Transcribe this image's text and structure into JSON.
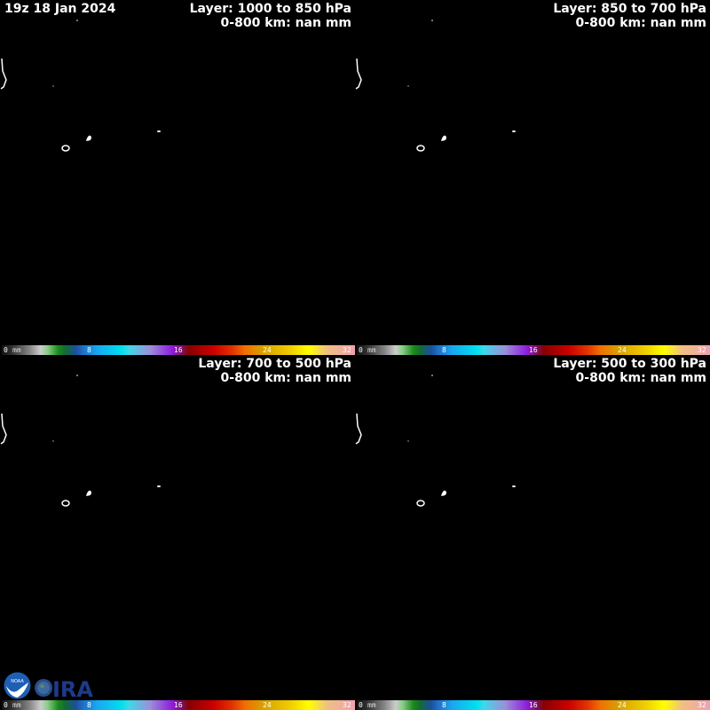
{
  "timestamp": "19z 18 Jan 2024",
  "panels": [
    {
      "layer": "Layer: 1000 to 850 hPa",
      "stat": "0-800 km: nan mm"
    },
    {
      "layer": "Layer: 850 to 700 hPa",
      "stat": "0-800 km: nan mm"
    },
    {
      "layer": "Layer: 700 to 500 hPa",
      "stat": "0-800 km: nan mm"
    },
    {
      "layer": "Layer: 500 to 300 hPa",
      "stat": "0-800 km: nan mm"
    }
  ],
  "colorbar": {
    "unit": "mm",
    "ticks": [
      "0",
      "8",
      "16",
      "24",
      "32"
    ]
  },
  "logos": {
    "noaa": "NOAA",
    "cira": "CIRA"
  }
}
